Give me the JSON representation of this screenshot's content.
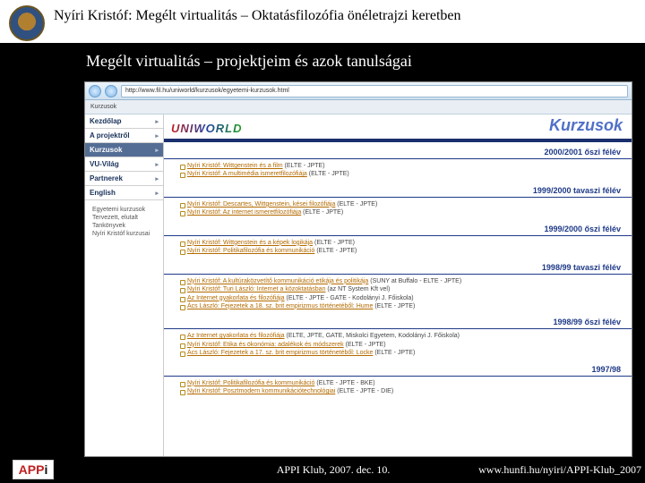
{
  "header": {
    "title": "Nyíri Kristóf: Megélt virtualitás – Oktatásfilozófia önéletrajzi keretben",
    "subtitle": "Megélt virtualitás – projektjeim és azok tanulságai"
  },
  "browser": {
    "url": "http://www.fil.hu/uniworld/kurzusok/egyetemi-kurzusok.html",
    "tab": "Kurzusok"
  },
  "sidebar": {
    "items": [
      {
        "label": "Kezdőlap"
      },
      {
        "label": "A projektről"
      },
      {
        "label": "Kurzusok"
      },
      {
        "label": "VU-Világ"
      },
      {
        "label": "Partnerek"
      },
      {
        "label": "English"
      }
    ],
    "subitems": [
      "Egyetemi kurzusok",
      "Tervezett, elutalt",
      "Tankönyvek",
      "Nyíri Kristóf kurzusai"
    ]
  },
  "page": {
    "logo": "UNIWORLD",
    "title": "Kurzusok"
  },
  "semesters": [
    {
      "name": "2000/2001 őszi félév",
      "courses": [
        {
          "author": "Nyíri Kristóf",
          "title": "Wittgenstein és a film",
          "aff": "(ELTE - JPTE)"
        },
        {
          "author": "Nyíri Kristóf",
          "title": "A multimédia ismeretfilozófiája",
          "aff": "(ELTE - JPTE)"
        }
      ]
    },
    {
      "name": "1999/2000 tavaszi félév",
      "courses": [
        {
          "author": "Nyíri Kristóf",
          "title": "Descartes, Wittgenstein, kései filozófiája",
          "aff": "(ELTE - JPTE)"
        },
        {
          "author": "Nyíri Kristóf",
          "title": "Az internet ismeretfilozófiája",
          "aff": "(ELTE - JPTE)"
        }
      ]
    },
    {
      "name": "1999/2000 őszi félév",
      "courses": [
        {
          "author": "Nyíri Kristóf",
          "title": "Wittgenstein és a képek logikája",
          "aff": "(ELTE - JPTE)"
        },
        {
          "author": "Nyíri Kristóf",
          "title": "Politikafilozófia és kommunikáció",
          "aff": "(ELTE - JPTE)"
        }
      ]
    },
    {
      "name": "1998/99 tavaszi félév",
      "courses": [
        {
          "author": "Nyíri Kristóf",
          "title": "A kultúraközvetítő kommunikáció etikája és politikája",
          "aff": "(SUNY at Buffalo - ELTE - JPTE)"
        },
        {
          "author": "Nyíri Kristóf",
          "title": "Turi László: Internet a közoktatásban",
          "aff": "(az NT System Kft vel)"
        },
        {
          "author": "—",
          "title": "Az Internet gyakorlata és filozófiája",
          "aff": "(ELTE - JPTE - GATE - Kodolányi J. Főiskola)"
        },
        {
          "author": "Ács László",
          "title": "Fejezetek a 18. sz. brit empirizmus történetéből: Hume",
          "aff": "(ELTE - JPTE)"
        }
      ]
    },
    {
      "name": "1998/99 őszi félév",
      "courses": [
        {
          "author": "—",
          "title": "Az Internet gyakorlata és filozófiája",
          "aff": "(ELTE, JPTE, GATE, Miskolci Egyetem, Kodolányi J. Főiskola)"
        },
        {
          "author": "Nyíri Kristóf",
          "title": "Etika és ökonómia: adalékok és módszerek",
          "aff": "(ELTE - JPTE)"
        },
        {
          "author": "Ács László",
          "title": "Fejezetek a 17. sz. brit empirizmus történetéből: Locke",
          "aff": "(ELTE - JPTE)"
        }
      ]
    },
    {
      "name": "1997/98",
      "courses": [
        {
          "author": "Nyíri Kristóf",
          "title": "Politikafilozófia és kommunikáció",
          "aff": "(ELTE - JPTE - BKE)"
        },
        {
          "author": "Nyíri Kristóf",
          "title": "Posztmodern kommunikációtechnológiai",
          "aff": "(ELTE - JPTE - DIE)"
        }
      ]
    }
  ],
  "footer": {
    "logo": "APP",
    "logo_i": "i",
    "center": "APPI Klub, 2007. dec. 10.",
    "right": "www.hunfi.hu/nyiri/APPI-Klub_2007"
  }
}
